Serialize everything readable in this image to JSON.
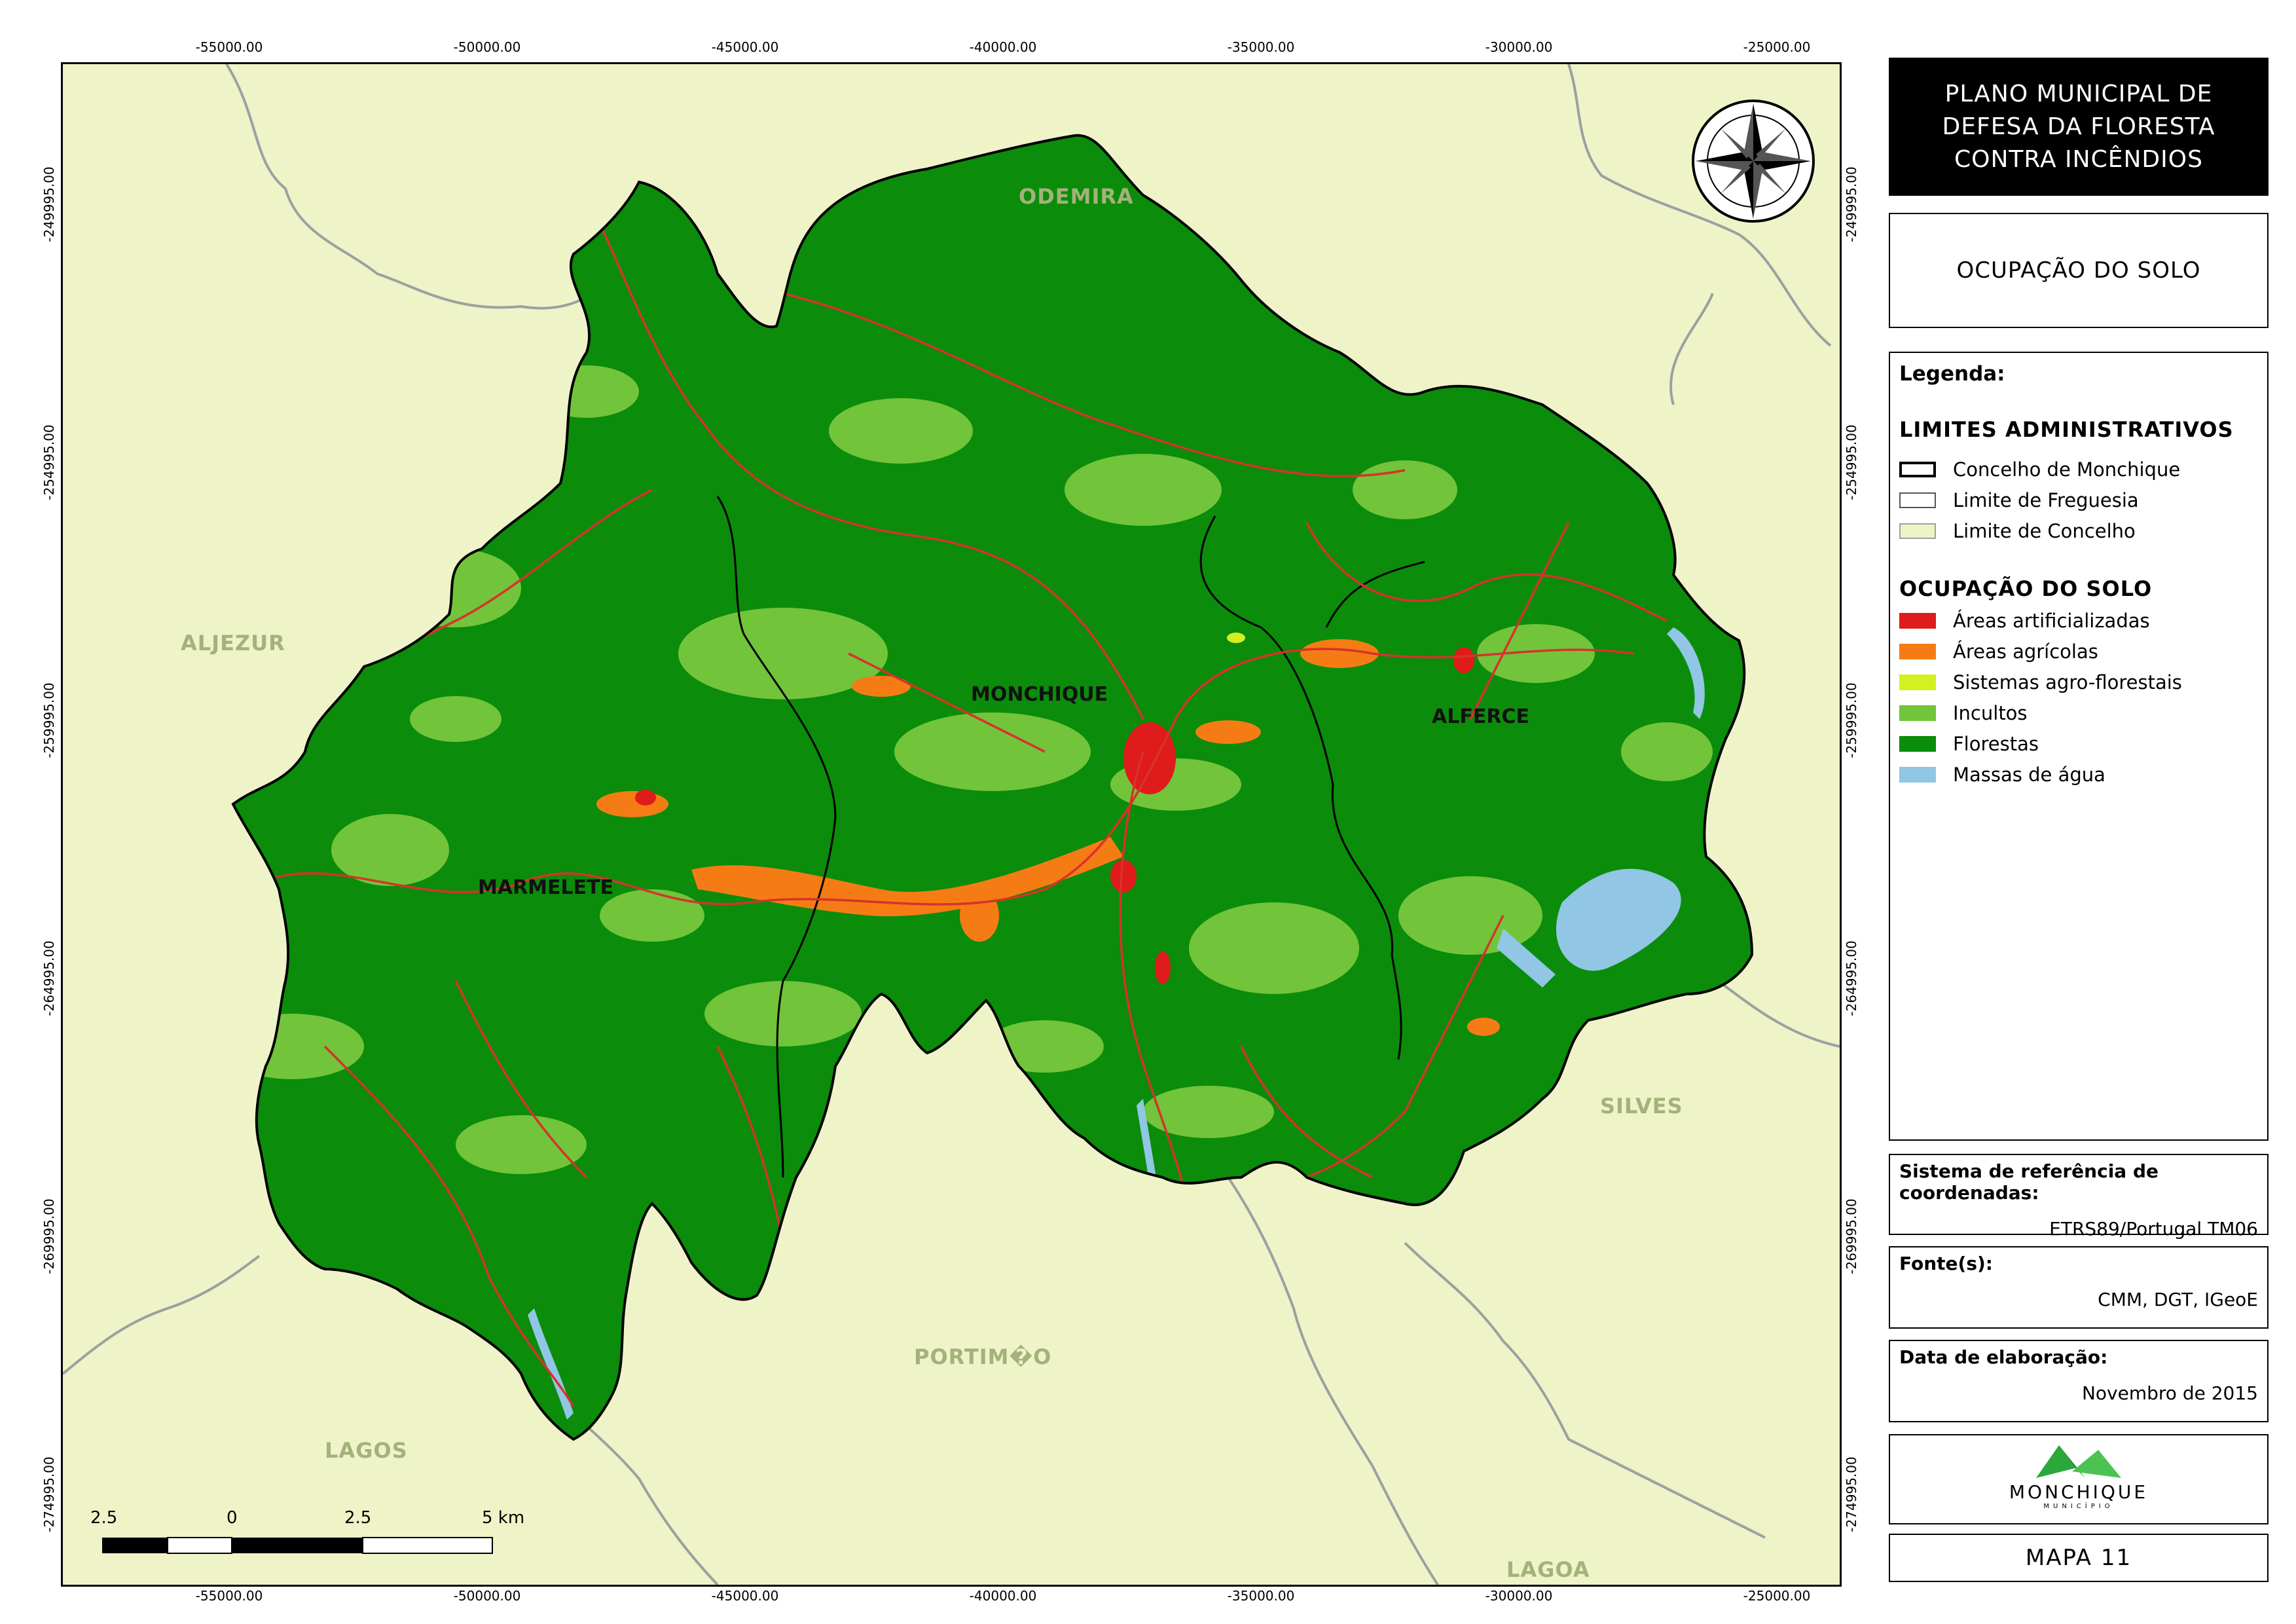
{
  "map": {
    "x_ticks": [
      "-55000.00",
      "-50000.00",
      "-45000.00",
      "-40000.00",
      "-35000.00",
      "-30000.00",
      "-25000.00"
    ],
    "y_ticks": [
      "-249995.00",
      "-254995.00",
      "-259995.00",
      "-264995.00",
      "-269995.00",
      "-274995.00"
    ],
    "municipalities": [
      "ODEMIRA",
      "ALJEZUR",
      "SILVES",
      "PORTIM�O",
      "LAGOS",
      "LAGOA"
    ],
    "parishes": [
      "MONCHIQUE",
      "ALFERCE",
      "MARMELETE"
    ],
    "scale": {
      "labels": [
        "2.5",
        "0",
        "2.5",
        "5 km"
      ]
    },
    "colors": {
      "background": "#eff3c8",
      "florestas": "#0b8c0b",
      "incultos": "#72c43a",
      "agricolas": "#f57c14",
      "artificiais": "#e01b1b",
      "agroflorestais": "#d4f020",
      "agua": "#91c6e4",
      "roads": "#d6332b"
    }
  },
  "panel": {
    "title": [
      "PLANO MUNICIPAL DE",
      "DEFESA DA FLORESTA",
      "CONTRA INCÊNDIOS"
    ],
    "subtitle": "OCUPAÇÃO DO SOLO",
    "legend": {
      "heading": "Legenda:",
      "admin_title": "LIMITES ADMINISTRATIVOS",
      "admin_items": [
        {
          "label": "Concelho de Monchique",
          "fill": "#ffffff",
          "border": "#000000"
        },
        {
          "label": "Limite de Freguesia",
          "fill": "#ffffff",
          "border": "#555555"
        },
        {
          "label": "Limite de Concelho",
          "fill": "#eff3c8",
          "border": "#9aa2a0"
        }
      ],
      "landuse_title": "OCUPAÇÃO DO SOLO",
      "landuse_items": [
        {
          "label": "Áreas artificializadas",
          "color": "#e01b1b"
        },
        {
          "label": "Áreas agrícolas",
          "color": "#f57c14"
        },
        {
          "label": "Sistemas agro-florestais",
          "color": "#d4f020"
        },
        {
          "label": "Incultos",
          "color": "#72c43a"
        },
        {
          "label": "Florestas",
          "color": "#0b8c0b"
        },
        {
          "label": "Massas de água",
          "color": "#91c6e4"
        }
      ]
    },
    "srs": {
      "heading": "Sistema de referência de coordenadas:",
      "value": "ETRS89/Portugal TM06"
    },
    "source": {
      "heading": "Fonte(s):",
      "value": "CMM, DGT, IGeoE"
    },
    "date": {
      "heading": "Data de elaboração:",
      "value": "Novembro de 2015"
    },
    "logo": {
      "name": "MONCHIQUE",
      "tagline": "MUNICÍPIO"
    },
    "map_number": "MAPA 11"
  }
}
